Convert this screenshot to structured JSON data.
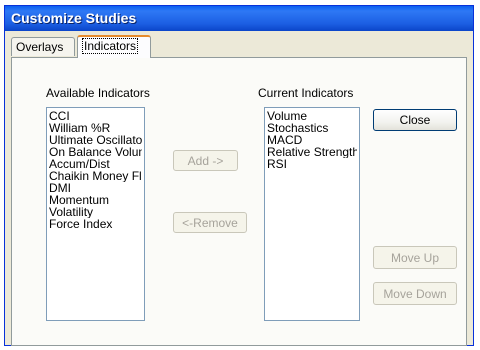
{
  "window": {
    "title": "Customize Studies"
  },
  "tabs": [
    {
      "label": "Overlays"
    },
    {
      "label": "Indicators"
    }
  ],
  "available": {
    "label": "Available Indicators",
    "items": [
      "CCI",
      "William %R",
      "Ultimate Oscillator",
      "On Balance Volume",
      "Accum/Dist",
      "Chaikin Money Flow",
      "DMI",
      "Momentum",
      "Volatility",
      "Force Index"
    ]
  },
  "current": {
    "label": "Current Indicators",
    "items": [
      "Volume",
      "Stochastics",
      "MACD",
      "Relative Strength",
      "RSI"
    ]
  },
  "buttons": {
    "add": "Add ->",
    "remove": "<-Remove",
    "close": "Close",
    "move_up": "Move Up",
    "move_down": "Move Down"
  }
}
